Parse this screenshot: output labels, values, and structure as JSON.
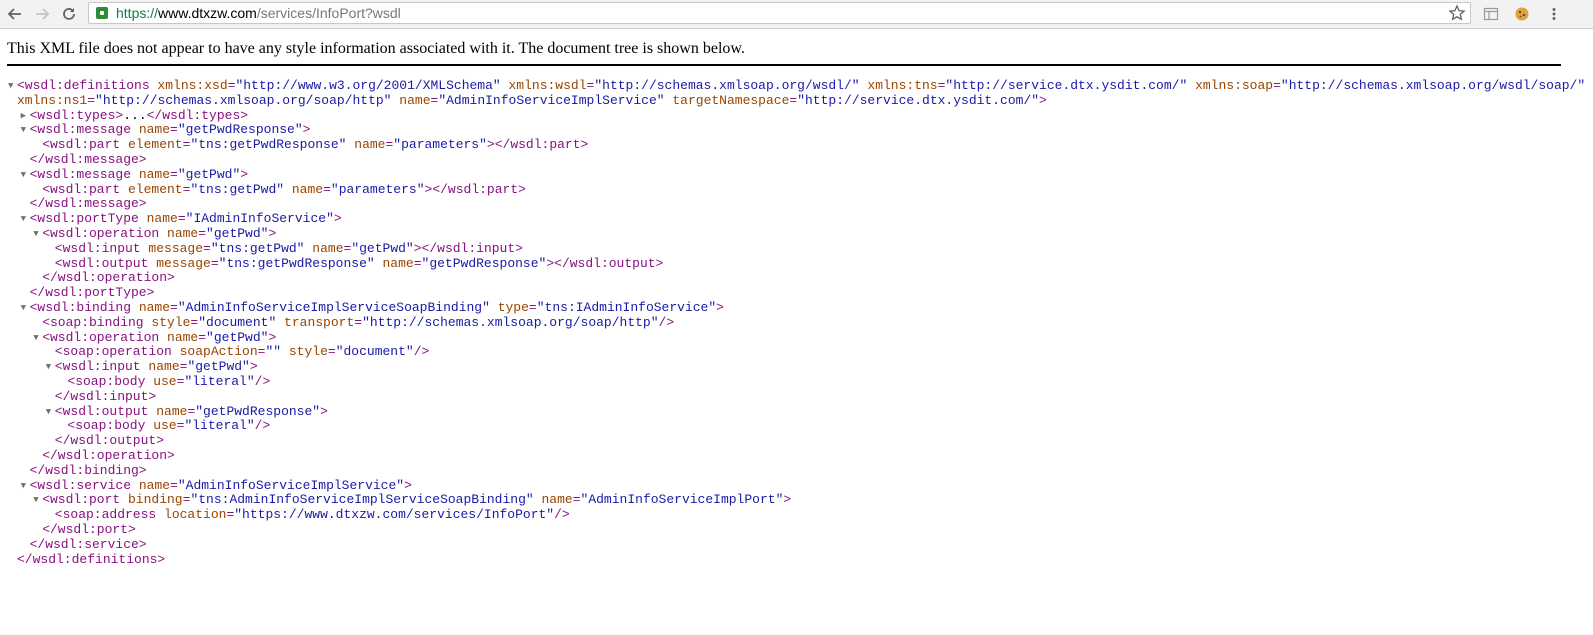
{
  "browser": {
    "url_scheme": "https://",
    "url_host": "www.dtxzw.com",
    "url_path": "/services/InfoPort?wsdl"
  },
  "notice": "This XML file does not appear to have any style information associated with it. The document tree is shown below.",
  "xml_lines": [
    {
      "indent": 0,
      "arrow": "open",
      "parts": [
        [
          "t",
          "<wsdl:definitions"
        ],
        [
          "a",
          " xmlns:xsd"
        ],
        [
          "t",
          "="
        ],
        [
          "v",
          "\"http://www.w3.org/2001/XMLSchema\""
        ],
        [
          "a",
          " xmlns:wsdl"
        ],
        [
          "t",
          "="
        ],
        [
          "v",
          "\"http://schemas.xmlsoap.org/wsdl/\""
        ],
        [
          "a",
          " xmlns:tns"
        ],
        [
          "t",
          "="
        ],
        [
          "v",
          "\"http://service.dtx.ysdit.com/\""
        ],
        [
          "a",
          " xmlns:soap"
        ],
        [
          "t",
          "="
        ],
        [
          "v",
          "\"http://schemas.xmlsoap.org/wsdl/soap/\""
        ]
      ]
    },
    {
      "indent": 0,
      "arrow": "none",
      "parts": [
        [
          "a",
          "xmlns:ns1"
        ],
        [
          "t",
          "="
        ],
        [
          "v",
          "\"http://schemas.xmlsoap.org/soap/http\""
        ],
        [
          "a",
          " name"
        ],
        [
          "t",
          "="
        ],
        [
          "v",
          "\"AdminInfoServiceImplService\""
        ],
        [
          "a",
          " targetNamespace"
        ],
        [
          "t",
          "="
        ],
        [
          "v",
          "\"http://service.dtx.ysdit.com/\""
        ],
        [
          "t",
          ">"
        ]
      ]
    },
    {
      "indent": 1,
      "arrow": "closed",
      "parts": [
        [
          "t",
          "<wsdl:types>"
        ],
        [
          "x",
          "..."
        ],
        [
          "t",
          "</wsdl:types>"
        ]
      ]
    },
    {
      "indent": 1,
      "arrow": "open",
      "parts": [
        [
          "t",
          "<wsdl:message"
        ],
        [
          "a",
          " name"
        ],
        [
          "t",
          "="
        ],
        [
          "v",
          "\"getPwdResponse\""
        ],
        [
          "t",
          ">"
        ]
      ]
    },
    {
      "indent": 2,
      "arrow": "none",
      "parts": [
        [
          "t",
          "<wsdl:part"
        ],
        [
          "a",
          " element"
        ],
        [
          "t",
          "="
        ],
        [
          "v",
          "\"tns:getPwdResponse\""
        ],
        [
          "a",
          " name"
        ],
        [
          "t",
          "="
        ],
        [
          "v",
          "\"parameters\""
        ],
        [
          "t",
          "></wsdl:part>"
        ]
      ]
    },
    {
      "indent": 1,
      "arrow": "none",
      "parts": [
        [
          "t",
          "</wsdl:message>"
        ]
      ]
    },
    {
      "indent": 1,
      "arrow": "open",
      "parts": [
        [
          "t",
          "<wsdl:message"
        ],
        [
          "a",
          " name"
        ],
        [
          "t",
          "="
        ],
        [
          "v",
          "\"getPwd\""
        ],
        [
          "t",
          ">"
        ]
      ]
    },
    {
      "indent": 2,
      "arrow": "none",
      "parts": [
        [
          "t",
          "<wsdl:part"
        ],
        [
          "a",
          " element"
        ],
        [
          "t",
          "="
        ],
        [
          "v",
          "\"tns:getPwd\""
        ],
        [
          "a",
          " name"
        ],
        [
          "t",
          "="
        ],
        [
          "v",
          "\"parameters\""
        ],
        [
          "t",
          "></wsdl:part>"
        ]
      ]
    },
    {
      "indent": 1,
      "arrow": "none",
      "parts": [
        [
          "t",
          "</wsdl:message>"
        ]
      ]
    },
    {
      "indent": 1,
      "arrow": "open",
      "parts": [
        [
          "t",
          "<wsdl:portType"
        ],
        [
          "a",
          " name"
        ],
        [
          "t",
          "="
        ],
        [
          "v",
          "\"IAdminInfoService\""
        ],
        [
          "t",
          ">"
        ]
      ]
    },
    {
      "indent": 2,
      "arrow": "open",
      "parts": [
        [
          "t",
          "<wsdl:operation"
        ],
        [
          "a",
          " name"
        ],
        [
          "t",
          "="
        ],
        [
          "v",
          "\"getPwd\""
        ],
        [
          "t",
          ">"
        ]
      ]
    },
    {
      "indent": 3,
      "arrow": "none",
      "parts": [
        [
          "t",
          "<wsdl:input"
        ],
        [
          "a",
          " message"
        ],
        [
          "t",
          "="
        ],
        [
          "v",
          "\"tns:getPwd\""
        ],
        [
          "a",
          " name"
        ],
        [
          "t",
          "="
        ],
        [
          "v",
          "\"getPwd\""
        ],
        [
          "t",
          "></wsdl:input>"
        ]
      ]
    },
    {
      "indent": 3,
      "arrow": "none",
      "parts": [
        [
          "t",
          "<wsdl:output"
        ],
        [
          "a",
          " message"
        ],
        [
          "t",
          "="
        ],
        [
          "v",
          "\"tns:getPwdResponse\""
        ],
        [
          "a",
          " name"
        ],
        [
          "t",
          "="
        ],
        [
          "v",
          "\"getPwdResponse\""
        ],
        [
          "t",
          "></wsdl:output>"
        ]
      ]
    },
    {
      "indent": 2,
      "arrow": "none",
      "parts": [
        [
          "t",
          "</wsdl:operation>"
        ]
      ]
    },
    {
      "indent": 1,
      "arrow": "none",
      "parts": [
        [
          "t",
          "</wsdl:portType>"
        ]
      ]
    },
    {
      "indent": 1,
      "arrow": "open",
      "parts": [
        [
          "t",
          "<wsdl:binding"
        ],
        [
          "a",
          " name"
        ],
        [
          "t",
          "="
        ],
        [
          "v",
          "\"AdminInfoServiceImplServiceSoapBinding\""
        ],
        [
          "a",
          " type"
        ],
        [
          "t",
          "="
        ],
        [
          "v",
          "\"tns:IAdminInfoService\""
        ],
        [
          "t",
          ">"
        ]
      ]
    },
    {
      "indent": 2,
      "arrow": "none",
      "parts": [
        [
          "t",
          "<soap:binding"
        ],
        [
          "a",
          " style"
        ],
        [
          "t",
          "="
        ],
        [
          "v",
          "\"document\""
        ],
        [
          "a",
          " transport"
        ],
        [
          "t",
          "="
        ],
        [
          "v",
          "\"http://schemas.xmlsoap.org/soap/http\""
        ],
        [
          "t",
          "/>"
        ]
      ]
    },
    {
      "indent": 2,
      "arrow": "open",
      "parts": [
        [
          "t",
          "<wsdl:operation"
        ],
        [
          "a",
          " name"
        ],
        [
          "t",
          "="
        ],
        [
          "v",
          "\"getPwd\""
        ],
        [
          "t",
          ">"
        ]
      ]
    },
    {
      "indent": 3,
      "arrow": "none",
      "parts": [
        [
          "t",
          "<soap:operation"
        ],
        [
          "a",
          " soapAction"
        ],
        [
          "t",
          "="
        ],
        [
          "v",
          "\"\""
        ],
        [
          "a",
          " style"
        ],
        [
          "t",
          "="
        ],
        [
          "v",
          "\"document\""
        ],
        [
          "t",
          "/>"
        ]
      ]
    },
    {
      "indent": 3,
      "arrow": "open",
      "parts": [
        [
          "t",
          "<wsdl:input"
        ],
        [
          "a",
          " name"
        ],
        [
          "t",
          "="
        ],
        [
          "v",
          "\"getPwd\""
        ],
        [
          "t",
          ">"
        ]
      ]
    },
    {
      "indent": 4,
      "arrow": "none",
      "parts": [
        [
          "t",
          "<soap:body"
        ],
        [
          "a",
          " use"
        ],
        [
          "t",
          "="
        ],
        [
          "v",
          "\"literal\""
        ],
        [
          "t",
          "/>"
        ]
      ]
    },
    {
      "indent": 3,
      "arrow": "none",
      "parts": [
        [
          "t",
          "</wsdl:input>"
        ]
      ]
    },
    {
      "indent": 3,
      "arrow": "open",
      "parts": [
        [
          "t",
          "<wsdl:output"
        ],
        [
          "a",
          " name"
        ],
        [
          "t",
          "="
        ],
        [
          "v",
          "\"getPwdResponse\""
        ],
        [
          "t",
          ">"
        ]
      ]
    },
    {
      "indent": 4,
      "arrow": "none",
      "parts": [
        [
          "t",
          "<soap:body"
        ],
        [
          "a",
          " use"
        ],
        [
          "t",
          "="
        ],
        [
          "v",
          "\"literal\""
        ],
        [
          "t",
          "/>"
        ]
      ]
    },
    {
      "indent": 3,
      "arrow": "none",
      "parts": [
        [
          "t",
          "</wsdl:output>"
        ]
      ]
    },
    {
      "indent": 2,
      "arrow": "none",
      "parts": [
        [
          "t",
          "</wsdl:operation>"
        ]
      ]
    },
    {
      "indent": 1,
      "arrow": "none",
      "parts": [
        [
          "t",
          "</wsdl:binding>"
        ]
      ]
    },
    {
      "indent": 1,
      "arrow": "open",
      "parts": [
        [
          "t",
          "<wsdl:service"
        ],
        [
          "a",
          " name"
        ],
        [
          "t",
          "="
        ],
        [
          "v",
          "\"AdminInfoServiceImplService\""
        ],
        [
          "t",
          ">"
        ]
      ]
    },
    {
      "indent": 2,
      "arrow": "open",
      "parts": [
        [
          "t",
          "<wsdl:port"
        ],
        [
          "a",
          " binding"
        ],
        [
          "t",
          "="
        ],
        [
          "v",
          "\"tns:AdminInfoServiceImplServiceSoapBinding\""
        ],
        [
          "a",
          " name"
        ],
        [
          "t",
          "="
        ],
        [
          "v",
          "\"AdminInfoServiceImplPort\""
        ],
        [
          "t",
          ">"
        ]
      ]
    },
    {
      "indent": 3,
      "arrow": "none",
      "parts": [
        [
          "t",
          "<soap:address"
        ],
        [
          "a",
          " location"
        ],
        [
          "t",
          "="
        ],
        [
          "v",
          "\"https://www.dtxzw.com/services/InfoPort\""
        ],
        [
          "t",
          "/>"
        ]
      ]
    },
    {
      "indent": 2,
      "arrow": "none",
      "parts": [
        [
          "t",
          "</wsdl:port>"
        ]
      ]
    },
    {
      "indent": 1,
      "arrow": "none",
      "parts": [
        [
          "t",
          "</wsdl:service>"
        ]
      ]
    },
    {
      "indent": 0,
      "arrow": "none",
      "parts": [
        [
          "t",
          "</wsdl:definitions>"
        ]
      ]
    }
  ]
}
